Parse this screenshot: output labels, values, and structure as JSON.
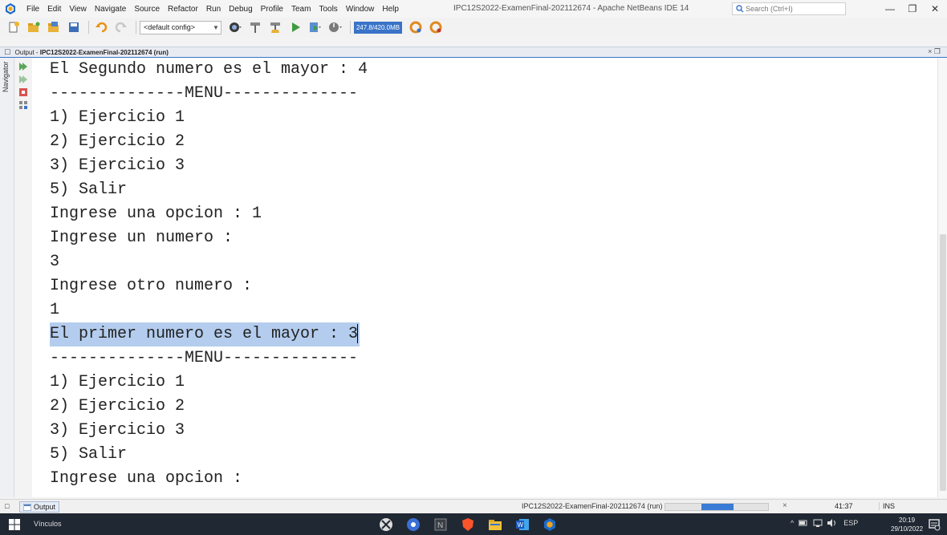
{
  "menubar": {
    "items": [
      "File",
      "Edit",
      "View",
      "Navigate",
      "Source",
      "Refactor",
      "Run",
      "Debug",
      "Profile",
      "Team",
      "Tools",
      "Window",
      "Help"
    ],
    "window_title": "IPC12S2022-ExamenFinal-202112674 - Apache NetBeans IDE 14",
    "search_placeholder": "Search (Ctrl+I)",
    "minimize": "—",
    "maximize": "❐",
    "close": "✕"
  },
  "toolbar": {
    "config_value": "<default config>",
    "memory_label": "247.8/420.0MB"
  },
  "output_panel": {
    "tab_prefix": "Output - ",
    "tab_title": "IPC12S2022-ExamenFinal-202112674 (run)",
    "controls": "× ❐",
    "navigator_label": "Navigator"
  },
  "console": {
    "lines": [
      "El Segundo numero es el mayor : 4",
      "--------------MENU--------------",
      "1) Ejercicio 1",
      "2) Ejercicio 2",
      "3) Ejercicio 3",
      "5) Salir",
      "Ingrese una opcion : 1",
      "Ingrese un numero :",
      "3",
      "Ingrese otro numero :",
      "1",
      "El primer numero es el mayor : 3",
      "--------------MENU--------------",
      "1) Ejercicio 1",
      "2) Ejercicio 2",
      "3) Ejercicio 3",
      "5) Salir",
      "Ingrese una opcion :"
    ],
    "selected_line_index": 11
  },
  "statusbar": {
    "output_tab": "Output",
    "run_label": "IPC12S2022-ExamenFinal-202112674 (run)",
    "progress_close": "×",
    "cursor_position": "41:37",
    "insert_mode": "INS"
  },
  "taskbar": {
    "links_label": "Vínculos",
    "tray_language": "ESP",
    "clock_time": "20:19",
    "clock_date": "29/10/2022"
  },
  "colors": {
    "accent": "#3a73c8",
    "selection": "#b4cdee",
    "taskbar": "#202833"
  }
}
